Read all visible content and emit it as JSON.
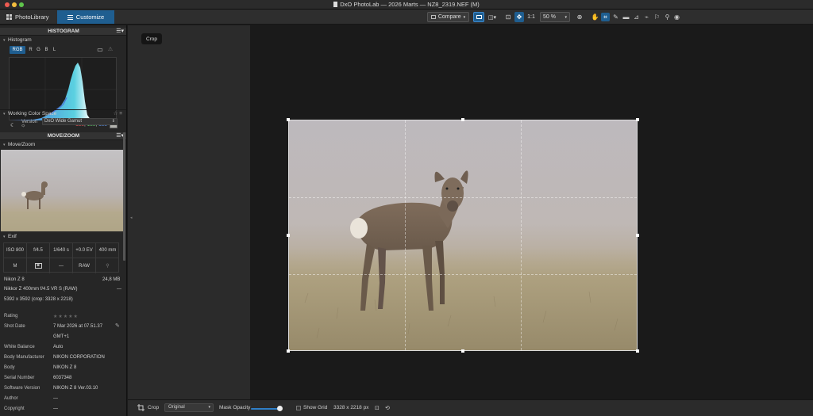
{
  "window": {
    "title": "DxO PhotoLab — 2026 Marts — NZ8_2319.NEF (M)"
  },
  "tabs": {
    "library": "PhotoLibrary",
    "customize": "Customize"
  },
  "toolbar": {
    "compare": "Compare",
    "one_to_one": "1:1",
    "zoom": "50 %"
  },
  "histogram_panel": {
    "header": "HISTOGRAM",
    "subheader": "Histogram",
    "channels": [
      "RGB",
      "R",
      "G",
      "B",
      "L"
    ],
    "values": {
      "r": "158",
      "g": "158",
      "b": "153"
    },
    "swatch_color": "#b3b3ae"
  },
  "working_color_space": {
    "header": "Working Color Space",
    "version_label": "Version",
    "version_value": "DxO Wide Gamut"
  },
  "move_zoom": {
    "header": "MOVE/ZOOM",
    "subheader": "Move/Zoom"
  },
  "exif": {
    "header": "Exif",
    "iso": "ISO 800",
    "aperture": "f/4.5",
    "shutter": "1/640 s",
    "ev": "+0.0 EV",
    "focal": "400 mm",
    "mode": "M",
    "dash": "—",
    "format": "RAW",
    "camera": "Nikon Z 8",
    "file_size": "24,8 MB",
    "lens": "Nikkor Z 400mm f/4.5 VR S (RAW)",
    "lens_dash": "—",
    "dimensions": "5392 x 3592 (crop: 3328 x 2218)",
    "fields": [
      {
        "label": "Rating",
        "value": ""
      },
      {
        "label": "Shot Date",
        "value": "7 Mar 2026 at 07.51.37"
      },
      {
        "label": "",
        "value": "GMT+1"
      },
      {
        "label": "White Balance",
        "value": "Auto"
      },
      {
        "label": "Body Manufacturer",
        "value": "NIKON CORPORATION"
      },
      {
        "label": "Body",
        "value": "NIKON Z 8"
      },
      {
        "label": "Serial Number",
        "value": "6037348"
      },
      {
        "label": "Software Version",
        "value": "NIKON Z 8 Ver.03.10"
      },
      {
        "label": "Author",
        "value": "—"
      },
      {
        "label": "Copyright",
        "value": "—"
      }
    ]
  },
  "viewer": {
    "tooltip": "Crop"
  },
  "bottom_bar": {
    "tool": "Crop",
    "ratio": "Original",
    "mask_opacity_label": "Mask Opacity",
    "mask_opacity": 0.9,
    "show_grid": "Show Grid",
    "crop_size": "3328 x 2218 px"
  }
}
